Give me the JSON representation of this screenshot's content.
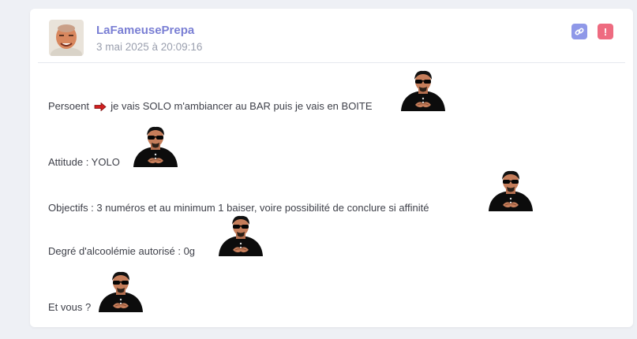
{
  "post": {
    "username": "LaFameusePrepa",
    "datetime": "3 mai 2025 à 20:09:16",
    "icons": {
      "link": "link-icon",
      "report": "exclamation-icon"
    },
    "colors": {
      "username": "#7a7fd4",
      "link_button": "#8f98e8",
      "report_button": "#ee6b80"
    },
    "report_glyph": "!",
    "lines": {
      "l1_before": "Persoent",
      "l1_after": "je vais SOLO m'ambiancer au BAR puis je vais en BOITE",
      "l2": "Attitude : YOLO",
      "l3": "Objectifs : 3 numéros et au minimum 1 baiser, voire possibilité de conclure si affinité",
      "l4": "Degré d'alcoolémie autorisé : 0g",
      "l5": "Et vous ?"
    }
  }
}
